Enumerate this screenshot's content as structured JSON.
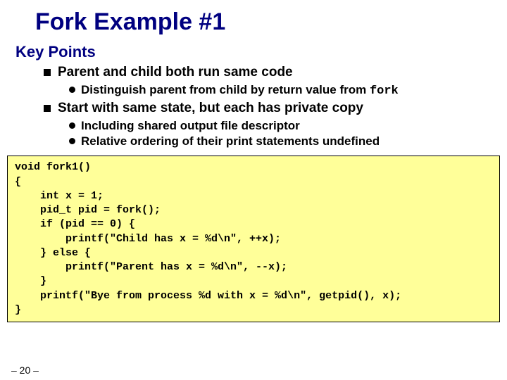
{
  "title": "Fork Example #1",
  "subheading": "Key Points",
  "bullets": [
    {
      "text": "Parent and child both run same code",
      "sub": [
        {
          "pre": "Distinguish parent from child by return value from ",
          "code": "fork"
        }
      ]
    },
    {
      "text": "Start with same state, but each has private copy",
      "sub": [
        {
          "pre": "Including shared output file descriptor"
        },
        {
          "pre": "Relative ordering of their print statements undefined"
        }
      ]
    }
  ],
  "code": "void fork1()\n{\n    int x = 1;\n    pid_t pid = fork();\n    if (pid == 0) {\n        printf(\"Child has x = %d\\n\", ++x);\n    } else {\n        printf(\"Parent has x = %d\\n\", --x);\n    }\n    printf(\"Bye from process %d with x = %d\\n\", getpid(), x);\n}",
  "page": "– 20 –"
}
